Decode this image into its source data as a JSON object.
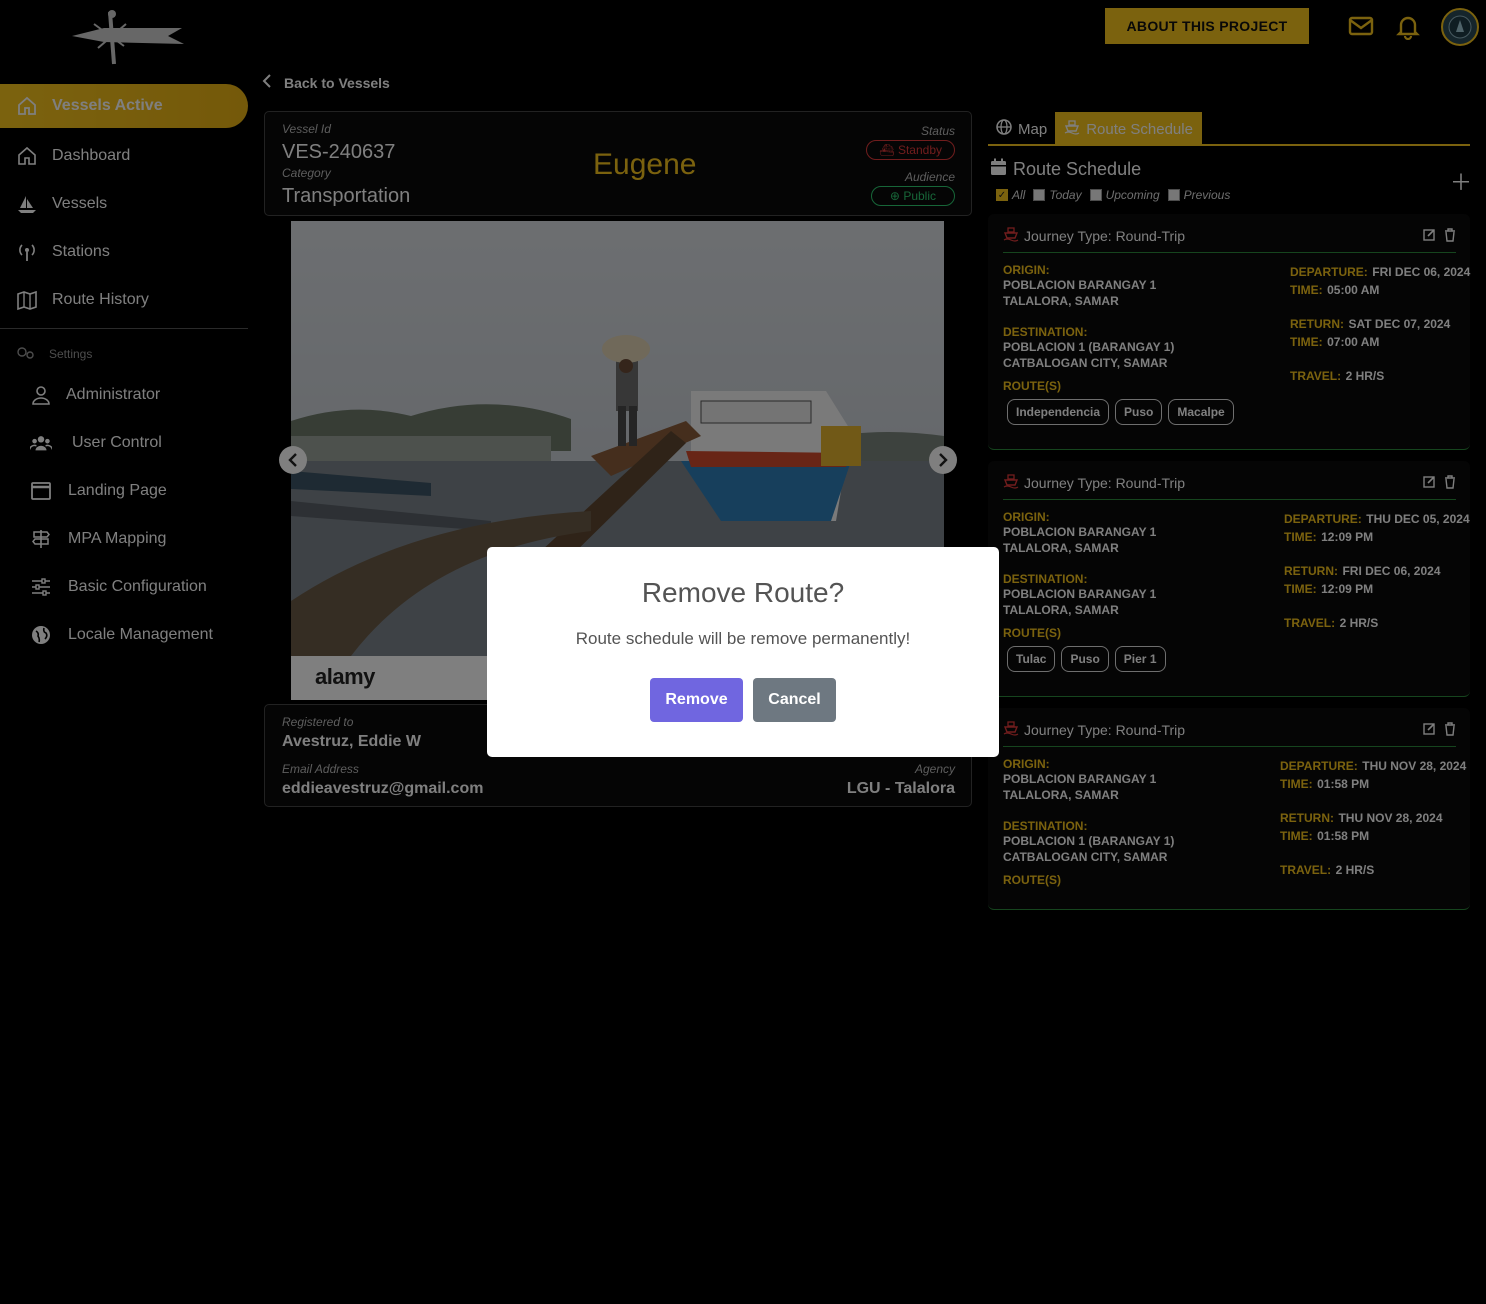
{
  "header": {
    "about_label": "ABOUT THIS PROJECT",
    "mail_icon": "envelope-icon",
    "bell_icon": "bell-icon",
    "brand_color": "#f7c51d"
  },
  "sidebar": {
    "items": [
      {
        "label": "Vessels Active",
        "icon": "home-icon"
      },
      {
        "label": "Dashboard",
        "icon": "home-icon"
      },
      {
        "label": "Vessels",
        "icon": "sailboat-icon"
      },
      {
        "label": "Stations",
        "icon": "antenna-icon"
      },
      {
        "label": "Route History",
        "icon": "map-icon"
      }
    ],
    "settings_label": "Settings",
    "settings_items": [
      {
        "label": "Administrator",
        "icon": "user-icon"
      },
      {
        "label": "User Control",
        "icon": "users-icon"
      },
      {
        "label": "Landing Page",
        "icon": "window-icon"
      },
      {
        "label": "MPA Mapping",
        "icon": "signpost-icon"
      },
      {
        "label": "Basic Configuration",
        "icon": "sliders-icon"
      },
      {
        "label": "Locale Management",
        "icon": "globe-icon"
      }
    ]
  },
  "back_label": "Back to Vessels",
  "vessel": {
    "id_label": "Vessel Id",
    "id": "VES-240637",
    "category_label": "Category",
    "category": "Transportation",
    "name": "Eugene",
    "status_label": "Status",
    "status": "Standby",
    "audience_label": "Audience",
    "audience": "Public"
  },
  "photo": {
    "brand": "alamy"
  },
  "registration": {
    "registered_label": "Registered to",
    "owner": "Avestruz, Eddie W",
    "email_label": "Email Address",
    "email": "eddieavestruz@gmail.com",
    "agency_label": "Agency",
    "agency": "LGU - Talalora"
  },
  "tabs": [
    {
      "label": "Map",
      "icon": "globe-icon"
    },
    {
      "label": "Route Schedule",
      "icon": "ship-icon"
    }
  ],
  "route_schedule": {
    "title": "Route Schedule",
    "filters": [
      {
        "label": "All",
        "checked": true
      },
      {
        "label": "Today",
        "checked": false
      },
      {
        "label": "Upcoming",
        "checked": false
      },
      {
        "label": "Previous",
        "checked": false
      }
    ],
    "labels": {
      "origin": "ORIGIN:",
      "destination": "DESTINATION:",
      "routes": "ROUTE(S)",
      "departure": "DEPARTURE:",
      "time": "TIME:",
      "return": "RETURN:",
      "travel": "TRAVEL:"
    },
    "cards": [
      {
        "title": "Journey Type: Round-Trip",
        "origin_1": "POBLACION BARANGAY 1",
        "origin_2": "TALALORA, SAMAR",
        "dest_1": "POBLACION 1 (BARANGAY 1)",
        "dest_2": "CATBALOGAN CITY, SAMAR",
        "departure": "FRI DEC 06, 2024",
        "dep_time": "05:00 AM",
        "return": "SAT DEC 07, 2024",
        "ret_time": "07:00 AM",
        "travel": "2 HR/S",
        "routes": [
          "Independencia",
          "Puso",
          "Macalpe"
        ]
      },
      {
        "title": "Journey Type: Round-Trip",
        "origin_1": "POBLACION BARANGAY 1",
        "origin_2": "TALALORA, SAMAR",
        "dest_1": "POBLACION BARANGAY 1",
        "dest_2": "TALALORA, SAMAR",
        "departure": "THU DEC 05, 2024",
        "dep_time": "12:09 PM",
        "return": "FRI DEC 06, 2024",
        "ret_time": "12:09 PM",
        "travel": "2 HR/S",
        "routes": [
          "Tulac",
          "Puso",
          "Pier 1"
        ]
      },
      {
        "title": "Journey Type: Round-Trip",
        "origin_1": "POBLACION BARANGAY 1",
        "origin_2": "TALALORA, SAMAR",
        "dest_1": "POBLACION 1 (BARANGAY 1)",
        "dest_2": "CATBALOGAN CITY, SAMAR",
        "departure": "THU NOV 28, 2024",
        "dep_time": "01:58 PM",
        "return": "THU NOV 28, 2024",
        "ret_time": "01:58 PM",
        "travel": "2 HR/S",
        "routes": []
      }
    ]
  },
  "modal": {
    "title": "Remove Route?",
    "message": "Route schedule will be remove permanently!",
    "confirm_label": "Remove",
    "cancel_label": "Cancel"
  }
}
